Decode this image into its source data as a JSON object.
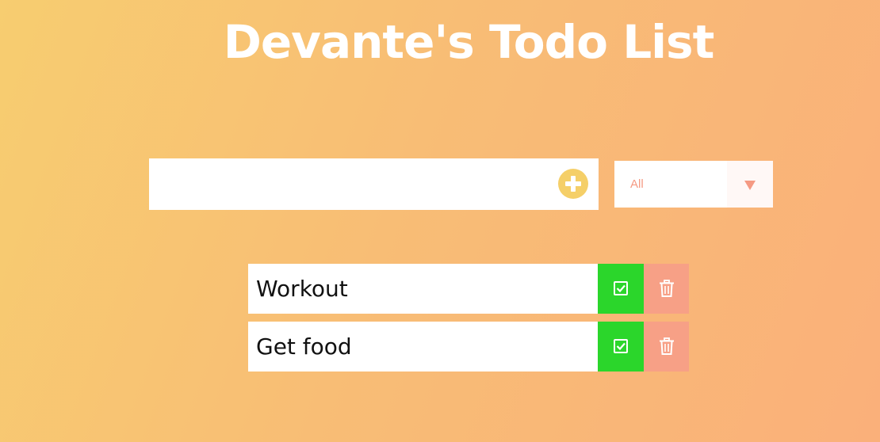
{
  "header": {
    "title": "Devante's Todo List"
  },
  "form": {
    "input_value": "",
    "input_placeholder": "",
    "add_icon": "plus-circle-icon",
    "filter_selected": "All",
    "filter_icon": "caret-down-icon"
  },
  "todos": [
    {
      "text": "Workout",
      "complete_icon": "check-square-icon",
      "delete_icon": "trash-icon"
    },
    {
      "text": "Get food",
      "complete_icon": "check-square-icon",
      "delete_icon": "trash-icon"
    }
  ],
  "colors": {
    "background_start": "#f7cd70",
    "background_end": "#fab07a",
    "add_button": "#f5cf68",
    "complete_button": "#2bd62b",
    "delete_button": "#f7a086",
    "filter_text": "#f59a83"
  }
}
